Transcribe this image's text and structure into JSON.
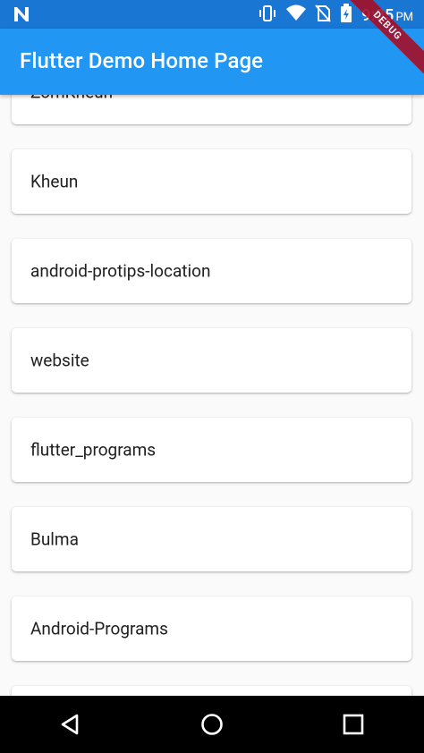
{
  "status_bar": {
    "time": "9:05",
    "ampm": "PM",
    "icons": [
      "notification-n-icon",
      "vibrate-icon",
      "wifi-icon",
      "no-sim-icon",
      "battery-charging-icon"
    ]
  },
  "app_bar": {
    "title": "Flutter Demo Home Page",
    "debug_banner": "DEBUG"
  },
  "list": {
    "items": [
      {
        "label": "ZomKheun"
      },
      {
        "label": "Kheun"
      },
      {
        "label": "android-protips-location"
      },
      {
        "label": "website"
      },
      {
        "label": "flutter_programs"
      },
      {
        "label": "Bulma"
      },
      {
        "label": "Android-Programs"
      },
      {
        "label": ""
      }
    ]
  },
  "nav_bar": {
    "buttons": [
      "back-icon",
      "home-icon",
      "recents-icon"
    ]
  },
  "colors": {
    "status_bar": "#1976d2",
    "app_bar": "#2196f3",
    "background": "#fafafa",
    "card": "#ffffff",
    "debug_ribbon": "#a40e26"
  }
}
